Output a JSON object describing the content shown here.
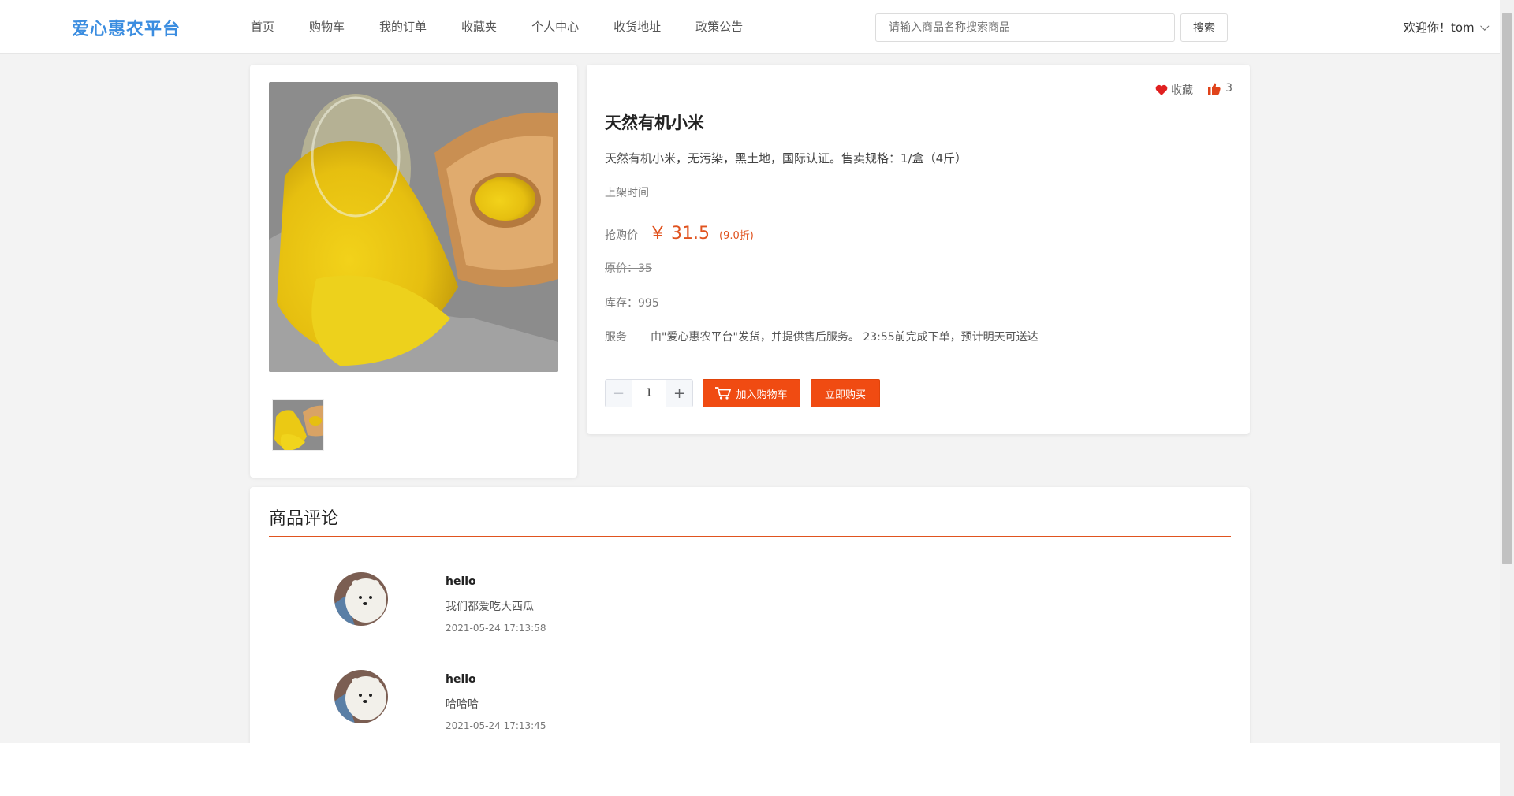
{
  "header": {
    "logo": "爱心惠农平台",
    "nav": [
      "首页",
      "购物车",
      "我的订单",
      "收藏夹",
      "个人中心",
      "收货地址",
      "政策公告"
    ],
    "search_placeholder": "请输入商品名称搜索商品",
    "search_button": "搜索",
    "welcome": "欢迎你！tom"
  },
  "product": {
    "favorite_label": "收藏",
    "like_count": "3",
    "title": "天然有机小米",
    "description": "天然有机小米，无污染，黑土地，国际认证。售卖规格：1/盒（4斤）",
    "listing_time_label": "上架时间",
    "price_label": "抢购价",
    "currency": "￥",
    "price": "31.5",
    "discount": "(9.0折)",
    "original_price": "原价：35",
    "stock": "库存：995",
    "service_label": "服务",
    "service_text": "由\"爱心惠农平台\"发货，并提供售后服务。 23:55前完成下单，预计明天可送达",
    "quantity": "1",
    "add_to_cart": "加入购物车",
    "buy_now": "立即购买"
  },
  "reviews": {
    "title": "商品评论",
    "items": [
      {
        "user": "hello",
        "text": "我们都爱吃大西瓜",
        "time": "2021-05-24 17:13:58"
      },
      {
        "user": "hello",
        "text": "哈哈哈",
        "time": "2021-05-24 17:13:45"
      }
    ]
  },
  "colors": {
    "accent": "#f04b12",
    "price": "#e0531f",
    "logo": "#3b8de0",
    "heart": "#e02020"
  }
}
